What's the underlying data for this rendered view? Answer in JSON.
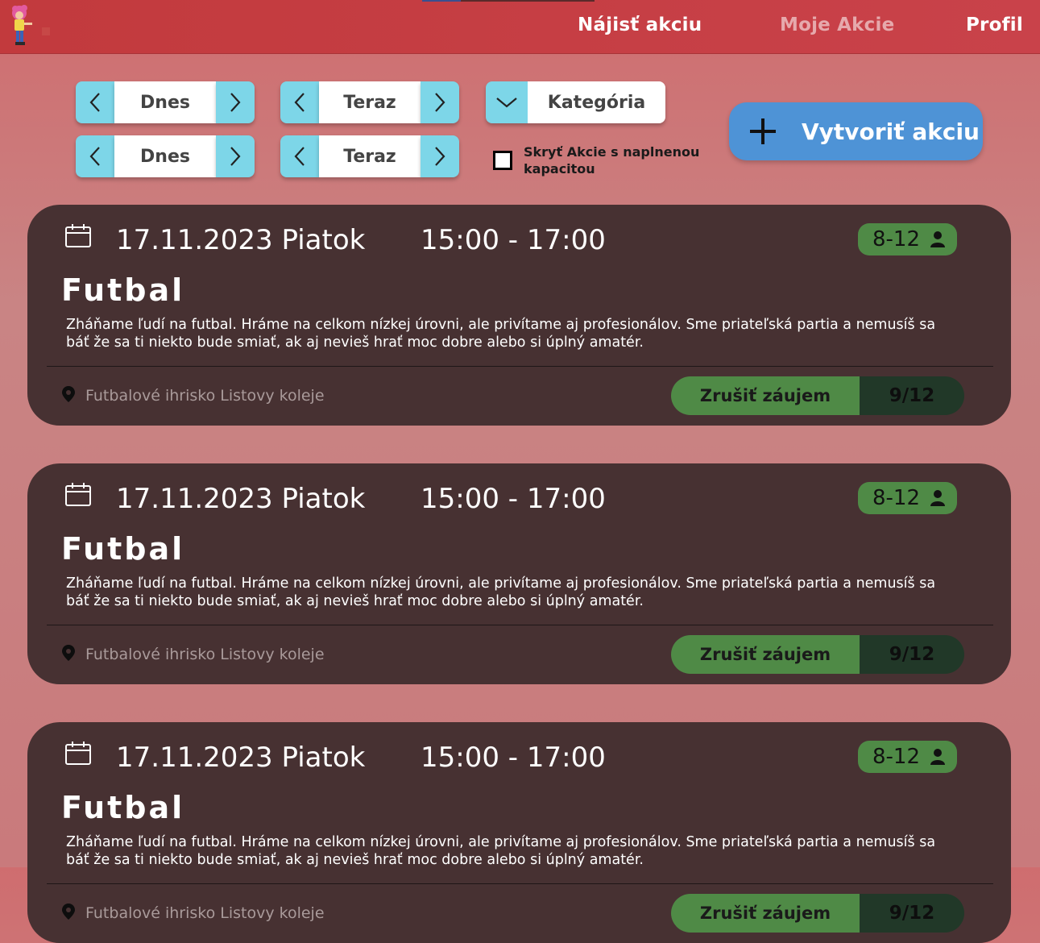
{
  "nav": {
    "items": [
      {
        "label": "Nájisť akciu",
        "active": true
      },
      {
        "label": "Moje Akcie",
        "active": false
      },
      {
        "label": "Profil",
        "active": false
      }
    ]
  },
  "filters": {
    "date_from": "Dnes",
    "date_to": "Dnes",
    "time_from": "Teraz",
    "time_to": "Teraz",
    "category": "Kategória",
    "hide_full_label": "Skryť Akcie s naplnenou kapacitou",
    "hide_full_checked": false
  },
  "create_button": {
    "label": "Vytvoriť akciu"
  },
  "events": [
    {
      "date": "17.11.2023 Piatok",
      "time": "15:00 - 17:00",
      "capacity": "8-12",
      "title": "Futbal",
      "description": "Zháňame ľudí na futbal. Hráme na celkom nízkej úrovni, ale privítame aj profesionálov. Sme priateľská partia a nemusíš sa báť že sa ti niekto bude smiať, ak aj nevieš hrať moc dobre alebo si úplný amatér.",
      "location": "Futbalové ihrisko Listovy koleje",
      "action": "Zrušiť záujem",
      "count": "9/12"
    },
    {
      "date": "17.11.2023 Piatok",
      "time": "15:00 - 17:00",
      "capacity": "8-12",
      "title": "Futbal",
      "description": "Zháňame ľudí na futbal. Hráme na celkom nízkej úrovni, ale privítame aj profesionálov. Sme priateľská partia a nemusíš sa báť že sa ti niekto bude smiať, ak aj nevieš hrať moc dobre alebo si úplný amatér.",
      "location": "Futbalové ihrisko Listovy koleje",
      "action": "Zrušiť záujem",
      "count": "9/12"
    },
    {
      "date": "17.11.2023 Piatok",
      "time": "15:00 - 17:00",
      "capacity": "8-12",
      "title": "Futbal",
      "description": "Zháňame ľudí na futbal. Hráme na celkom nízkej úrovni, ale privítame aj profesionálov. Sme priateľská partia a nemusíš sa báť že sa ti niekto bude smiať, ak aj nevieš hrať moc dobre alebo si úplný amatér.",
      "location": "Futbalové ihrisko Listovy koleje",
      "action": "Zrušiť záujem",
      "count": "9/12"
    }
  ],
  "colors": {
    "header": "#c23a3d",
    "stepper_accent": "#7dd6e8",
    "create_button": "#4e93d6",
    "card_bg": "#473132",
    "green": "#4f8a46",
    "dark_green": "#213828"
  }
}
